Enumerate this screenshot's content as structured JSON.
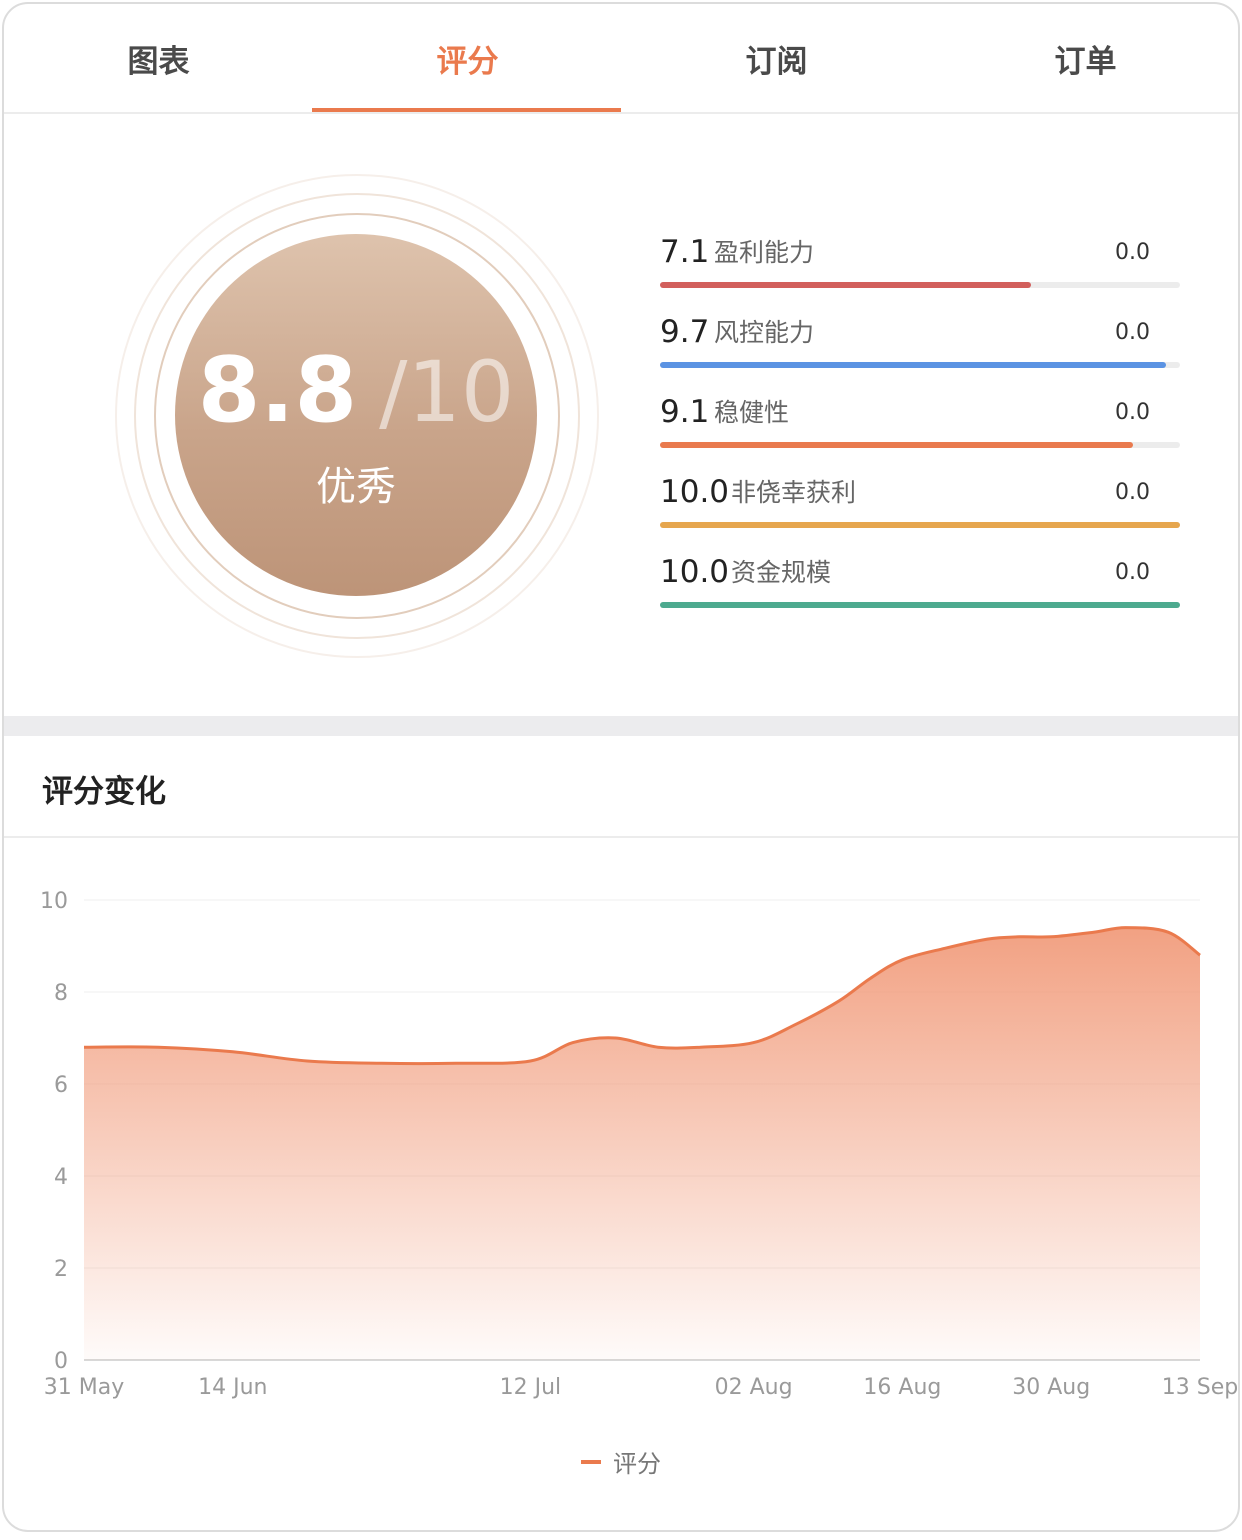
{
  "tabs": [
    {
      "label": "图表"
    },
    {
      "label": "评分"
    },
    {
      "label": "订阅"
    },
    {
      "label": "订单"
    }
  ],
  "active_tab": 1,
  "score": {
    "value": "8.8",
    "max": "/10",
    "grade": "优秀"
  },
  "metrics": [
    {
      "value": "7.1",
      "label": "盈利能力",
      "right": "0.0",
      "fraction": 0.714,
      "color": "#d25f5c"
    },
    {
      "value": "9.7",
      "label": "风控能力",
      "right": "0.0",
      "fraction": 0.973,
      "color": "#5b93e3"
    },
    {
      "value": "9.1",
      "label": "稳健性",
      "right": "0.0",
      "fraction": 0.91,
      "color": "#e97a4e"
    },
    {
      "value": "10.0",
      "label": "非侥幸获利",
      "right": "0.0",
      "fraction": 1.0,
      "color": "#e6a64e"
    },
    {
      "value": "10.0",
      "label": "资金规模",
      "right": "0.0",
      "fraction": 1.0,
      "color": "#4daa8f"
    }
  ],
  "chart_section": {
    "title": "评分变化"
  },
  "chart_data": {
    "type": "area",
    "x": [
      "2023-05-31",
      "2023-06-07",
      "2023-06-14",
      "2023-06-21",
      "2023-06-28",
      "2023-07-05",
      "2023-07-12",
      "2023-07-16",
      "2023-07-20",
      "2023-07-24",
      "2023-07-28",
      "2023-08-02",
      "2023-08-06",
      "2023-08-10",
      "2023-08-13",
      "2023-08-16",
      "2023-08-20",
      "2023-08-24",
      "2023-08-27",
      "2023-08-30",
      "2023-09-03",
      "2023-09-06",
      "2023-09-10",
      "2023-09-13"
    ],
    "values": [
      6.8,
      6.8,
      6.7,
      6.5,
      6.45,
      6.45,
      6.5,
      6.9,
      7.0,
      6.8,
      6.8,
      6.9,
      7.3,
      7.8,
      8.3,
      8.7,
      8.95,
      9.15,
      9.2,
      9.2,
      9.3,
      9.4,
      9.3,
      8.8
    ],
    "x_ticks": [
      "31 May",
      "14 Jun",
      "12 Jul",
      "02 Aug",
      "16 Aug",
      "30 Aug",
      "13 Sep"
    ],
    "y_ticks": [
      "0",
      "2",
      "4",
      "6",
      "8",
      "10"
    ],
    "ylim": [
      0,
      10
    ],
    "grid": true,
    "legend": "bottom-center",
    "series_name": "评分",
    "color": "#ea7a4d"
  }
}
